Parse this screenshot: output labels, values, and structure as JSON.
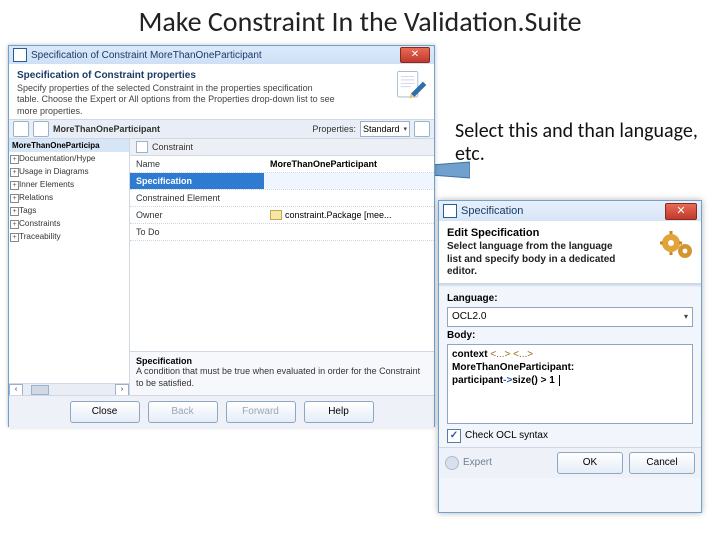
{
  "slide": {
    "title": "Make Constraint In the Validation.Suite",
    "annotation": "Select this and than language, etc."
  },
  "win1": {
    "title": "Specification of Constraint MoreThanOneParticipant",
    "header_title": "Specification of Constraint properties",
    "header_body": "Specify properties of the selected Constraint in the properties specification table. Choose the Expert or All options from the Properties drop-down list to see more properties.",
    "breadcrumb": "MoreThanOneParticipant",
    "properties_label": "Properties:",
    "properties_value": "Standard",
    "tree": {
      "selected": "MoreThanOneParticipa",
      "nodes": [
        "Documentation/Hype",
        "Usage in Diagrams",
        "Inner Elements",
        "Relations",
        "Tags",
        "Constraints",
        "Traceability"
      ]
    },
    "grid": {
      "section": "Constraint",
      "rows": [
        {
          "k": "Name",
          "v": "MoreThanOneParticipant"
        },
        {
          "k": "Specification",
          "v": ""
        },
        {
          "k": "Constrained Element",
          "v": ""
        },
        {
          "k": "Owner",
          "v": "constraint.Package [mee..."
        },
        {
          "k": "To Do",
          "v": ""
        }
      ],
      "selected_index": 1,
      "desc_title": "Specification",
      "desc_body": "A condition that must be true when evaluated in order for the Constraint to be satisfied."
    },
    "buttons": {
      "close": "Close",
      "back": "Back",
      "forward": "Forward",
      "help": "Help"
    }
  },
  "win2": {
    "title": "Specification",
    "header_title": "Edit Specification",
    "header_body": "Select language from the language list and specify body in a dedicated editor.",
    "language_label": "Language:",
    "language_value": "OCL2.0",
    "body_label": "Body:",
    "body_lines": {
      "l1_kw": "context",
      "l1_type": "<...> <...>",
      "l2": "MoreThanOneParticipant:",
      "l3_a": "participant",
      "l3_op": "->",
      "l3_b": "size() > 1"
    },
    "check_label": "Check OCL syntax",
    "expert": "Expert",
    "ok": "OK",
    "cancel": "Cancel"
  },
  "icons": {
    "close": "✕",
    "tri": "▾",
    "check": "✓",
    "pencil": "pencil",
    "gears": "gears",
    "arrow": "arrow"
  }
}
